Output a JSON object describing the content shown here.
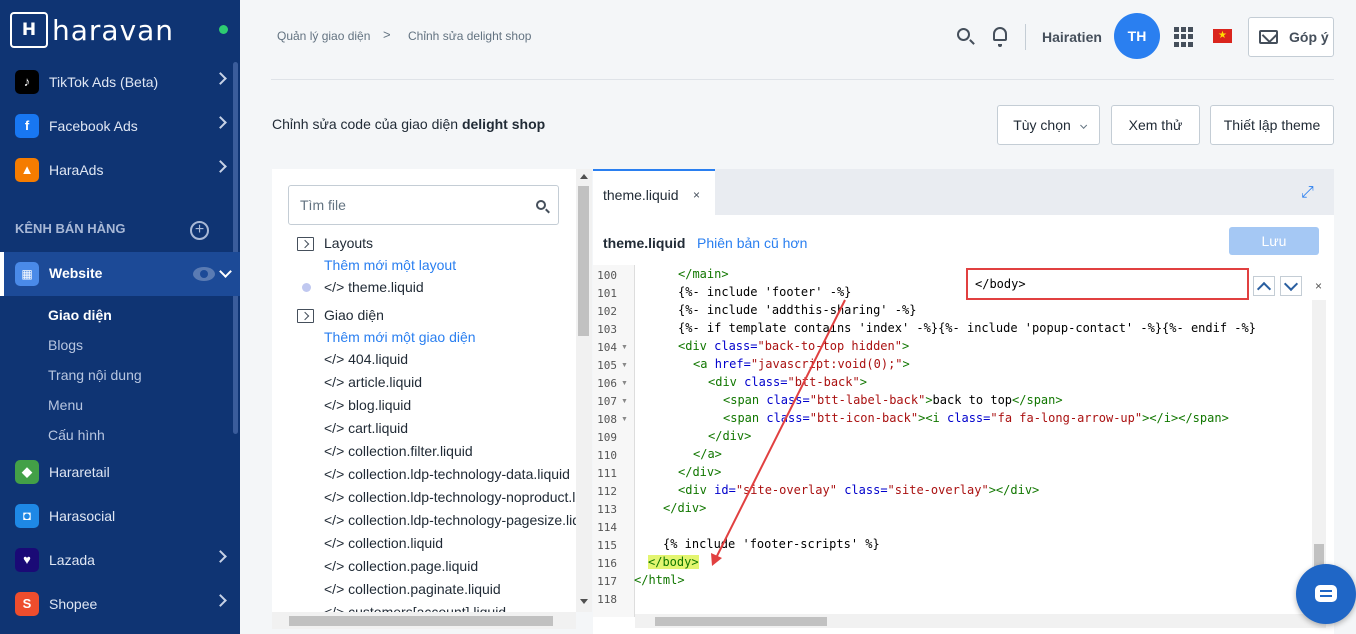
{
  "brand": {
    "logo_mark": "H",
    "name": "haravan"
  },
  "sidebar": {
    "top_items": [
      {
        "label": "TikTok Ads (Beta)",
        "icon": "tiktok-icon",
        "color": "#000000"
      },
      {
        "label": "Facebook Ads",
        "icon": "facebook-icon",
        "color": "#1877f2"
      },
      {
        "label": "HaraAds",
        "icon": "haraads-icon",
        "color": "#f57c00"
      }
    ],
    "section_title": "KÊNH BÁN HÀNG",
    "website_label": "Website",
    "website_sub": [
      "Giao diện",
      "Blogs",
      "Trang nội dung",
      "Menu",
      "Cấu hình"
    ],
    "bottom_items": [
      {
        "label": "Hararetail",
        "icon": "hararetail-icon",
        "color": "#43a047"
      },
      {
        "label": "Harasocial",
        "icon": "harasocial-icon",
        "color": "#1e88e5"
      },
      {
        "label": "Lazada",
        "icon": "lazada-icon",
        "color": "#1a0a76"
      },
      {
        "label": "Shopee",
        "icon": "shopee-icon",
        "color": "#ee4d2d"
      }
    ]
  },
  "header": {
    "breadcrumb": [
      "Quản lý giao diện",
      "Chỉnh sửa delight shop"
    ],
    "breadcrumb_separator": ">",
    "username": "Hairatien",
    "avatar_initials": "TH",
    "feedback_label": "Góp ý",
    "flag_star": "★"
  },
  "page": {
    "title_prefix": "Chỉnh sửa code của giao diện ",
    "theme_name": "delight shop",
    "options_label": "Tùy chọn",
    "preview_label": "Xem thử",
    "setup_label": "Thiết lập theme"
  },
  "files": {
    "search_placeholder": "Tìm file",
    "layouts_label": "Layouts",
    "add_layout": "Thêm mới một layout",
    "layout_files": [
      "</> theme.liquid"
    ],
    "templates_label": "Giao diện",
    "add_template": "Thêm mới một giao diện",
    "template_files": [
      "</> 404.liquid",
      "</> article.liquid",
      "</> blog.liquid",
      "</> cart.liquid",
      "</> collection.filter.liquid",
      "</> collection.ldp-technology-data.liquid",
      "</> collection.ldp-technology-noproduct.liquid",
      "</> collection.ldp-technology-pagesize.liquid",
      "</> collection.liquid",
      "</> collection.page.liquid",
      "</> collection.paginate.liquid",
      "</> customers[account].liquid"
    ]
  },
  "editor": {
    "tab_label": "theme.liquid",
    "tab_close": "×",
    "file_name": "theme.liquid",
    "older_versions": "Phiên bản cũ hơn",
    "save_label": "Lưu",
    "expand_icon": "⤢",
    "find_value": "</body>",
    "find_close": "×",
    "lines": [
      {
        "n": "100",
        "fold": false
      },
      {
        "n": "101",
        "fold": false
      },
      {
        "n": "102",
        "fold": false
      },
      {
        "n": "103",
        "fold": false
      },
      {
        "n": "104",
        "fold": true
      },
      {
        "n": "105",
        "fold": true
      },
      {
        "n": "106",
        "fold": true
      },
      {
        "n": "107",
        "fold": true
      },
      {
        "n": "108",
        "fold": true
      },
      {
        "n": "109",
        "fold": false
      },
      {
        "n": "110",
        "fold": false
      },
      {
        "n": "111",
        "fold": false
      },
      {
        "n": "112",
        "fold": false
      },
      {
        "n": "113",
        "fold": false
      },
      {
        "n": "114",
        "fold": false
      },
      {
        "n": "115",
        "fold": false
      },
      {
        "n": "116",
        "fold": false
      },
      {
        "n": "117",
        "fold": false
      },
      {
        "n": "118",
        "fold": false
      }
    ],
    "code": {
      "l100": "</main>",
      "l101": "{%- include 'footer' -%}",
      "l102": "{%- include 'addthis-sharing' -%}",
      "l103": "{%- if template contains 'index' -%}{%- include 'popup-contact' -%}{%- endif -%}",
      "l104a": "<div ",
      "l104b": "class=",
      "l104c": "\"back-to-top hidden\"",
      "l104d": ">",
      "l105a": "<a ",
      "l105b": "href=",
      "l105c": "\"javascript:void(0);\"",
      "l105d": ">",
      "l106a": "<div ",
      "l106b": "class=",
      "l106c": "\"btt-back\"",
      "l106d": ">",
      "l107a": "<span ",
      "l107b": "class=",
      "l107c": "\"btt-label-back\"",
      "l107d": ">",
      "l107e": "back to top",
      "l107f": "</span>",
      "l108a": "<span ",
      "l108b": "class=",
      "l108c": "\"btt-icon-back\"",
      "l108d": ">",
      "l108e": "<i ",
      "l108f": "class=",
      "l108g": "\"fa fa-long-arrow-up\"",
      "l108h": "></i></span>",
      "l109": "</div>",
      "l110": "</a>",
      "l111": "</div>",
      "l112a": "<div ",
      "l112b": "id=",
      "l112c": "\"site-overlay\"",
      "l112d": " class=",
      "l112e": "\"site-overlay\"",
      "l112f": "></div>",
      "l113": "</div>",
      "l115": "{% include 'footer-scripts' %}",
      "l116": "</body>",
      "l117": "</html>"
    }
  },
  "colors": {
    "sidebar_bg": "#0f3473",
    "accent": "#2a7ff0",
    "annotation_red": "#e14040"
  }
}
